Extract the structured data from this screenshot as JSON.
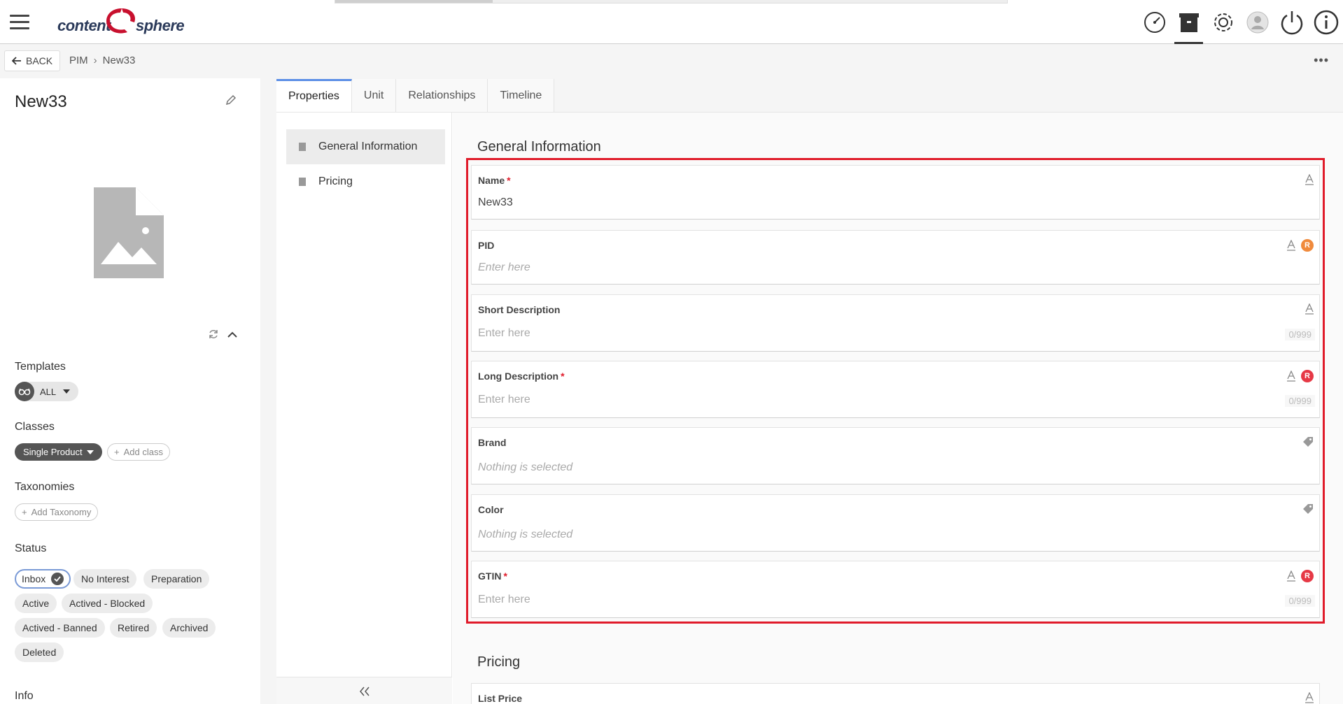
{
  "app": {
    "logo_left": "content",
    "logo_right": "sphere"
  },
  "topbar": {
    "icons": [
      "dashboard-icon",
      "archive-icon",
      "settings-icon",
      "user-icon",
      "power-icon",
      "info-icon"
    ],
    "active_icon": "archive-icon"
  },
  "breadcrumb": {
    "back_label": "BACK",
    "items": [
      "PIM",
      "New33"
    ]
  },
  "item": {
    "title": "New33",
    "templates_label": "Templates",
    "template_value": "ALL",
    "classes_label": "Classes",
    "class_value": "Single Product",
    "add_class": "Add class",
    "taxonomies_label": "Taxonomies",
    "add_taxonomy": "Add Taxonomy",
    "status_label": "Status",
    "statuses": [
      "Inbox",
      "No Interest",
      "Preparation",
      "Active",
      "Actived - Blocked",
      "Actived - Banned",
      "Retired",
      "Archived",
      "Deleted"
    ],
    "selected_status": "Inbox",
    "info_label": "Info"
  },
  "tabs": [
    "Properties",
    "Unit",
    "Relationships",
    "Timeline"
  ],
  "active_tab": "Properties",
  "subnav": [
    "General Information",
    "Pricing"
  ],
  "sections": {
    "general": "General Information",
    "pricing": "Pricing"
  },
  "fields": {
    "name": {
      "label": "Name",
      "value": "New33"
    },
    "pid": {
      "label": "PID",
      "placeholder": "Enter here"
    },
    "short_desc": {
      "label": "Short Description",
      "placeholder": "Enter here",
      "counter": "0/999"
    },
    "long_desc": {
      "label": "Long Description",
      "placeholder": "Enter here",
      "counter": "0/999"
    },
    "brand": {
      "label": "Brand",
      "empty": "Nothing is selected"
    },
    "color": {
      "label": "Color",
      "empty": "Nothing is selected"
    },
    "gtin": {
      "label": "GTIN",
      "placeholder": "Enter here",
      "counter": "0/999"
    },
    "list_price": {
      "label": "List Price"
    }
  },
  "required_marker": "*",
  "badge_letter": "R",
  "colors": {
    "accent": "#5b8ee6",
    "highlight": "#e01b2a",
    "badge_orange": "#f08a3c",
    "badge_red": "#e63946"
  }
}
